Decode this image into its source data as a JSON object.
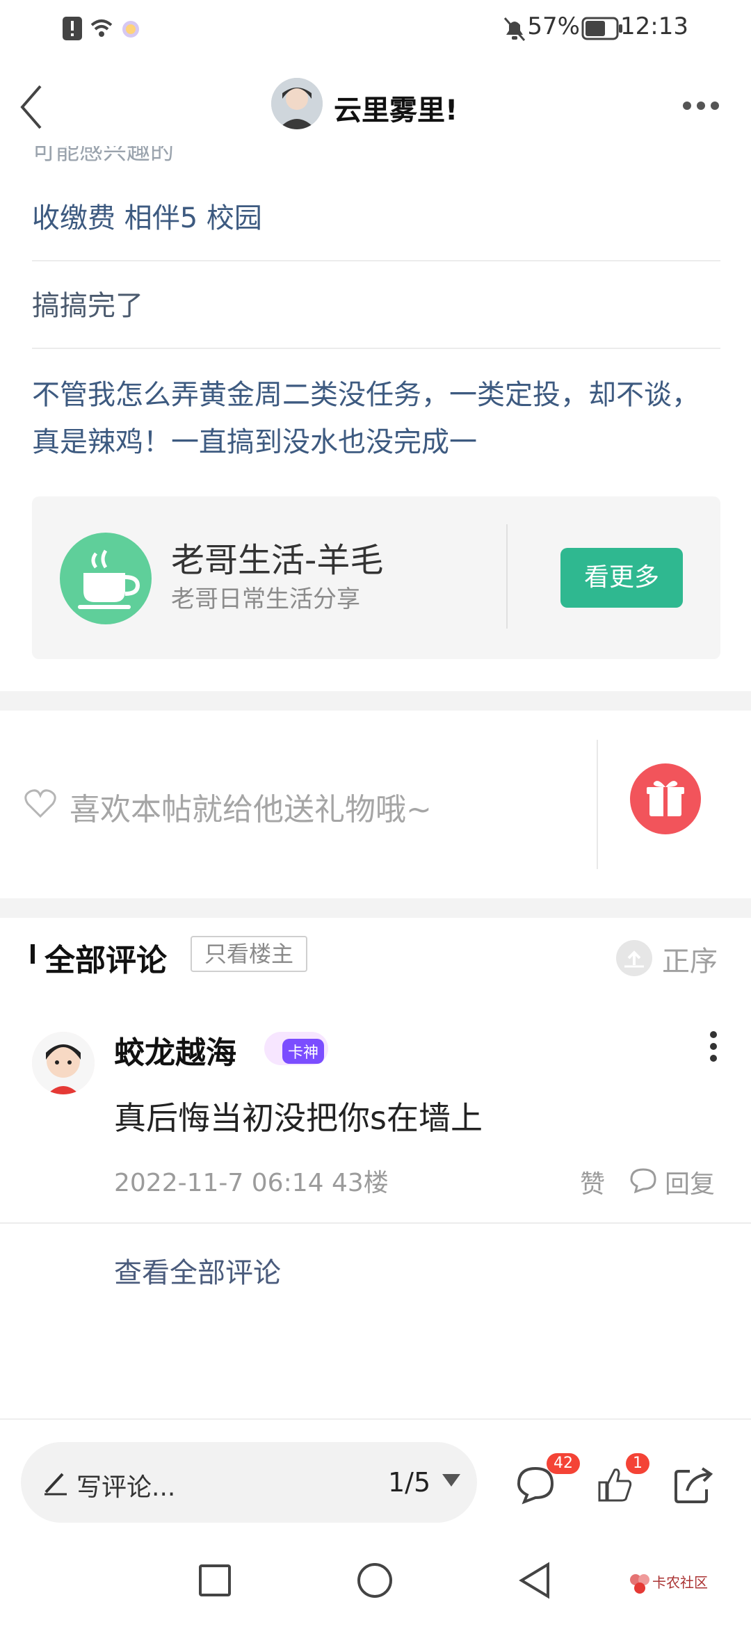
{
  "status_bar": {
    "battery_percent": "57%",
    "time": "12:13"
  },
  "header": {
    "title": "云里雾里!"
  },
  "related": {
    "faded_label": "可能感兴趣的",
    "items": [
      "收缴费 相伴5 校园",
      "搞搞完了",
      "不管我怎么弄黄金周二类没任务，一类定投，却不谈，真是辣鸡！一直搞到没水也没完成一"
    ]
  },
  "promo": {
    "name": "老哥生活-羊毛",
    "subtitle": "老哥日常生活分享",
    "more_label": "看更多",
    "icon_color": "#5fcf9a",
    "button_color": "#2fb890"
  },
  "gift": {
    "prompt": "喜欢本帖就给他送礼物哦~",
    "button_color": "#f2545b"
  },
  "comments": {
    "section_title": "全部评论",
    "only_op_label": "只看楼主",
    "order_label": "正序",
    "items": [
      {
        "author": "蛟龙越海",
        "badge": "卡神",
        "body": "真后悔当初没把你s在墙上",
        "meta": "2022-11-7 06:14  43楼",
        "like_label": "赞",
        "reply_label": "回复"
      }
    ],
    "view_all_label": "查看全部评论"
  },
  "bottom_bar": {
    "write_placeholder": "写评论...",
    "page_indicator": "1/5",
    "comment_count": "42",
    "like_count": "1"
  },
  "watermark": {
    "text": "卡农社区"
  }
}
